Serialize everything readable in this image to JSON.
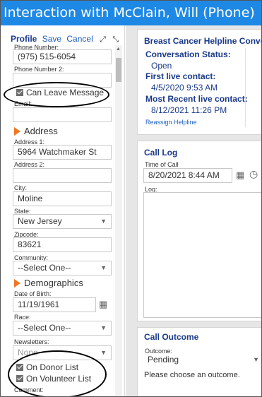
{
  "window": {
    "title": "Interaction with McClain, Will (Phone)"
  },
  "profile": {
    "title": "Profile",
    "save_label": "Save",
    "cancel_label": "Cancel",
    "expand_icon": "expand-icon",
    "collapse_icon": "collapse-icon",
    "fields": {
      "phone_number_label": "Phone Number:",
      "phone_number_value": "(975) 515-6054",
      "phone_number2_label": "Phone Number 2:",
      "phone_number2_value": "",
      "can_leave_message_label": "Can Leave Message",
      "email_label": "Email:",
      "email_value": "",
      "address_section": "Address",
      "address1_label": "Address 1:",
      "address1_value": "5964 Watchmaker St",
      "address2_label": "Address 2:",
      "address2_value": "",
      "city_label": "City:",
      "city_value": "Moline",
      "state_label": "State:",
      "state_value": "New Jersey",
      "zipcode_label": "Zipcode:",
      "zipcode_value": "83621",
      "community_label": "Community:",
      "community_value": "--Select One--",
      "demographics_section": "Demographics",
      "dob_label": "Date of Birth:",
      "dob_value": "11/19/1961",
      "race_label": "Race:",
      "race_value": "--Select One--",
      "newsletters_label": "Newsletters:",
      "newsletters_value": "None",
      "on_donor_list_label": "On Donor List",
      "on_volunteer_list_label": "On Volunteer List",
      "comment_label": "Comment:"
    }
  },
  "helpline_card": {
    "title": "Breast Cancer Helpline Conve",
    "status_label": "Conversation Status:",
    "status_value": "Open",
    "first_contact_label": "First live contact:",
    "first_contact_value": "4/5/2020 9:53 AM",
    "recent_contact_label": "Most Recent live contact:",
    "recent_contact_value": "8/12/2021 11:26 PM",
    "reassign_link": "Reassign Helpline"
  },
  "call_log": {
    "title": "Call Log",
    "time_label": "Time of Call",
    "time_value": "8/20/2021 8:44 AM",
    "log_label": "Log:",
    "calendar_icon": "calendar-icon",
    "clock_icon": "clock-icon"
  },
  "call_outcome": {
    "title": "Call Outcome",
    "outcome_label": "Outcome:",
    "outcome_value": "Pending",
    "hint": "Please choose an outcome."
  },
  "colors": {
    "titlebar": "#1e88e5",
    "heading": "#1a3a8a",
    "link": "#1e5fbf",
    "section_arrow": "#ee7722"
  }
}
